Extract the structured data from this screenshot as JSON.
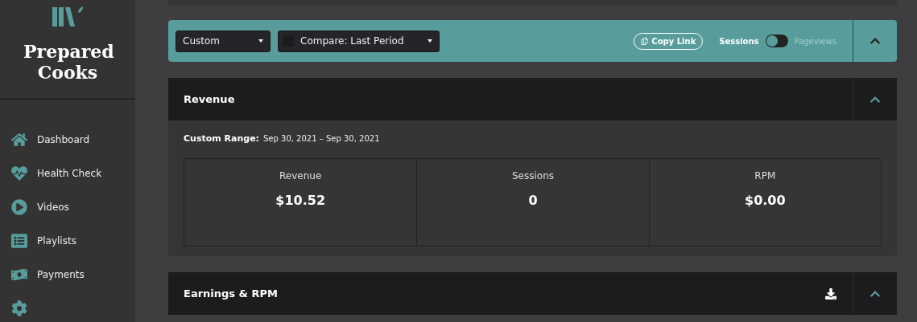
{
  "sidebar": {
    "brand": "Prepared Cooks",
    "items": [
      {
        "label": "Dashboard",
        "kind": "home"
      },
      {
        "label": "Health Check",
        "kind": "health"
      },
      {
        "label": "Videos",
        "kind": "play"
      },
      {
        "label": "Playlists",
        "kind": "list"
      },
      {
        "label": "Payments",
        "kind": "money"
      },
      {
        "kind": "gear"
      }
    ]
  },
  "toolbar": {
    "range_select": "Custom",
    "compare": {
      "label": "Compare: Last Period",
      "checked": false
    },
    "copy_link": "Copy Link",
    "metric_toggle": [
      {
        "label": "Sessions",
        "selected": true
      },
      {
        "label": "Pageviews",
        "selected": false
      }
    ]
  },
  "revenue": {
    "title": "Revenue",
    "range_label": "Custom Range:",
    "range_value": "Sep 30, 2021 – Sep 30, 2021",
    "stats": [
      {
        "label": "Revenue",
        "value": "$10.52"
      },
      {
        "label": "Sessions",
        "value": "0"
      },
      {
        "label": "RPM",
        "value": "$0.00"
      }
    ]
  },
  "earnings": {
    "title": "Earnings & RPM"
  }
}
